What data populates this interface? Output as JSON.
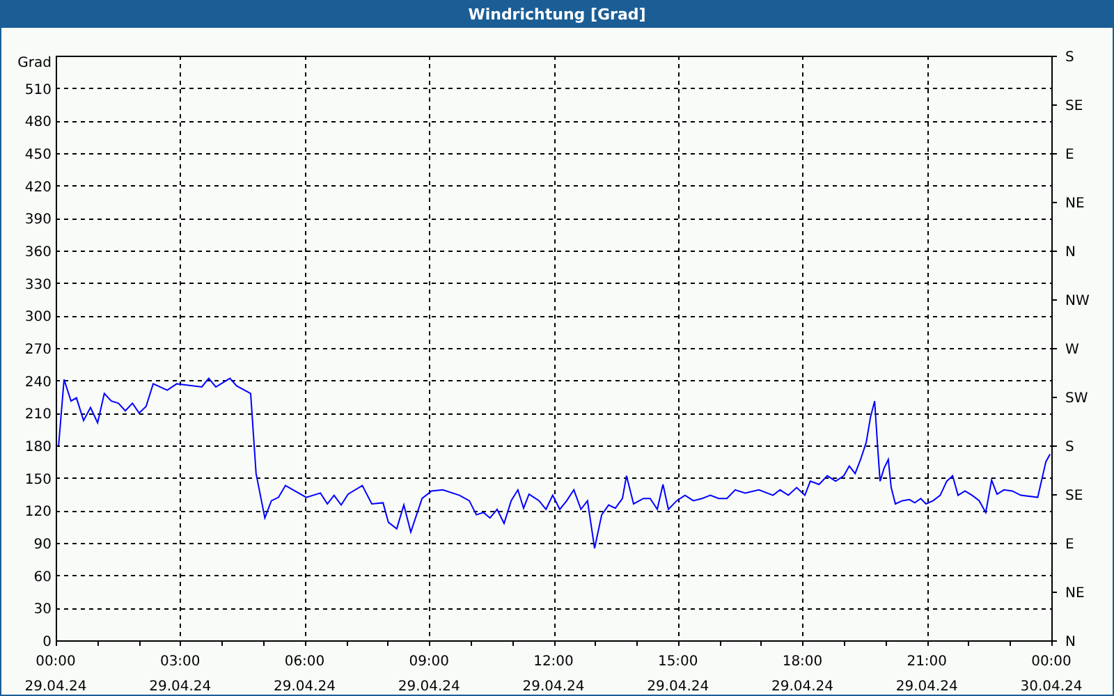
{
  "window": {
    "title": "Windrichtung [Grad]"
  },
  "chart": {
    "date_labels": [
      "29.04.24",
      "29.04.24",
      "29.04.24",
      "29.04.24",
      "29.04.24",
      "29.04.24",
      "29.04.24",
      "29.04.24",
      "30.04.24"
    ],
    "compass_labels": [
      "S",
      "SE",
      "E",
      "NE",
      "N",
      "NW",
      "W",
      "SW",
      "S",
      "SE",
      "E",
      "NE",
      "N"
    ],
    "chart_data": {
      "type": "line",
      "ylabel": "Grad",
      "ylim": [
        0,
        540
      ],
      "xlim": [
        0,
        24
      ],
      "grid": true,
      "yticks": [
        0,
        30,
        60,
        90,
        120,
        150,
        180,
        210,
        240,
        270,
        300,
        330,
        360,
        390,
        420,
        450,
        480,
        510
      ],
      "xticks": [
        {
          "value": 0,
          "label": "00:00"
        },
        {
          "value": 3,
          "label": "03:00"
        },
        {
          "value": 6,
          "label": "06:00"
        },
        {
          "value": 9,
          "label": "09:00"
        },
        {
          "value": 12,
          "label": "12:00"
        },
        {
          "value": 15,
          "label": "15:00"
        },
        {
          "value": 18,
          "label": "18:00"
        },
        {
          "value": 21,
          "label": "21:00"
        },
        {
          "value": 24,
          "label": "00:00"
        }
      ],
      "x": [
        0.07,
        0.2,
        0.37,
        0.5,
        0.67,
        0.84,
        1.01,
        1.17,
        1.34,
        1.51,
        1.68,
        1.85,
        2.01,
        2.18,
        2.35,
        2.69,
        2.92,
        3.52,
        3.69,
        3.86,
        4.2,
        4.36,
        4.7,
        4.83,
        5.04,
        5.2,
        5.37,
        5.54,
        6.04,
        6.38,
        6.55,
        6.71,
        6.88,
        7.05,
        7.39,
        7.62,
        7.89,
        8.02,
        8.22,
        8.39,
        8.56,
        8.83,
        9.06,
        9.33,
        9.73,
        9.97,
        10.14,
        10.31,
        10.47,
        10.64,
        10.81,
        10.98,
        11.14,
        11.28,
        11.41,
        11.65,
        11.82,
        11.98,
        12.15,
        12.32,
        12.49,
        12.66,
        12.82,
        12.99,
        13.16,
        13.33,
        13.49,
        13.66,
        13.76,
        13.93,
        14.17,
        14.33,
        14.5,
        14.64,
        14.77,
        14.97,
        15.17,
        15.37,
        15.58,
        15.78,
        15.98,
        16.18,
        16.38,
        16.62,
        16.95,
        17.29,
        17.46,
        17.66,
        17.86,
        18.06,
        18.19,
        18.4,
        18.6,
        18.8,
        19.0,
        19.13,
        19.27,
        19.4,
        19.54,
        19.64,
        19.74,
        19.81,
        19.87,
        19.97,
        20.07,
        20.14,
        20.24,
        20.41,
        20.58,
        20.71,
        20.85,
        20.98,
        21.15,
        21.32,
        21.48,
        21.62,
        21.75,
        21.92,
        22.09,
        22.26,
        22.42,
        22.56,
        22.69,
        22.86,
        23.06,
        23.26,
        23.67,
        23.87,
        23.97
      ],
      "series": [
        {
          "color": "#0000ff",
          "values": [
            180,
            241,
            221,
            224,
            203,
            215,
            201,
            228,
            221,
            219,
            212,
            219,
            210,
            216,
            237,
            231,
            237,
            234,
            242,
            234,
            242,
            235,
            228,
            154,
            113,
            129,
            132,
            143,
            132,
            136,
            126,
            134,
            125,
            135,
            143,
            126,
            127,
            109,
            103,
            125,
            100,
            131,
            138,
            139,
            134,
            129,
            116,
            118,
            113,
            121,
            108,
            129,
            139,
            122,
            135,
            129,
            121,
            134,
            121,
            129,
            139,
            121,
            129,
            85,
            116,
            125,
            122,
            131,
            152,
            126,
            131,
            131,
            121,
            144,
            121,
            129,
            134,
            129,
            131,
            134,
            131,
            131,
            139,
            136,
            139,
            134,
            139,
            134,
            141,
            134,
            147,
            144,
            152,
            147,
            152,
            161,
            154,
            167,
            183,
            206,
            221,
            180,
            147,
            159,
            167,
            141,
            126,
            129,
            130,
            127,
            131,
            126,
            129,
            134,
            147,
            152,
            134,
            138,
            134,
            129,
            118,
            148,
            135,
            139,
            138,
            134,
            132,
            165,
            172
          ]
        }
      ]
    }
  }
}
